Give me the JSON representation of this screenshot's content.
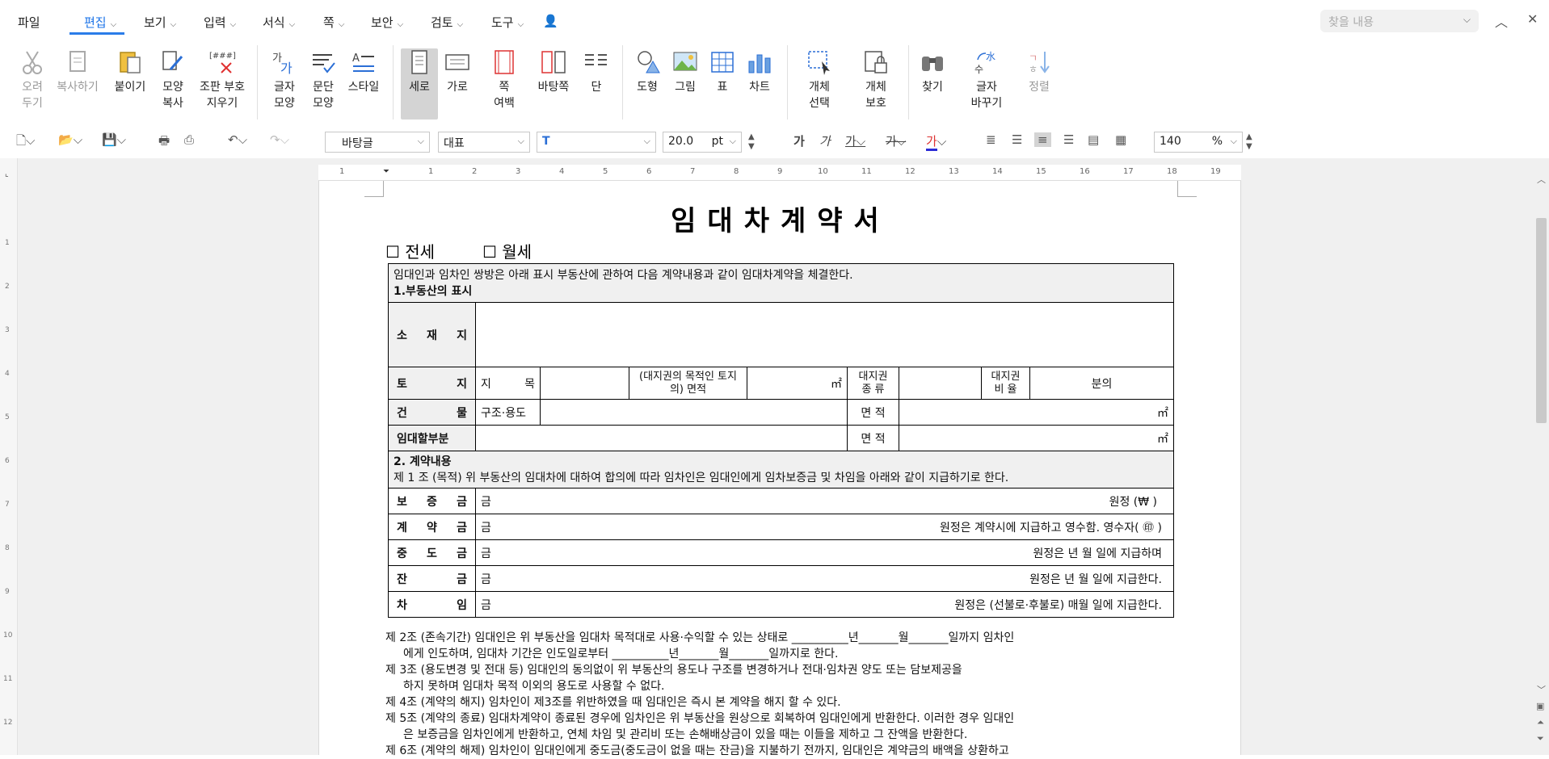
{
  "menu": {
    "file": "파일",
    "edit": "편집",
    "view": "보기",
    "input": "입력",
    "format": "서식",
    "page": "쪽",
    "security": "보안",
    "review": "검토",
    "tools": "도구"
  },
  "search": {
    "placeholder": "찾을 내용"
  },
  "ribbon": {
    "cut": "오려\n두기",
    "copy": "복사하기",
    "paste": "붙이기",
    "format_copy": "모양\n복사",
    "clear_layout": "조판 부호\n지우기",
    "char_shape": "글자\n모양",
    "para_shape": "문단\n모양",
    "style": "스타일",
    "portrait": "세로",
    "landscape": "가로",
    "margin": "쪽\n여백",
    "background": "바탕쪽",
    "columns": "단",
    "shape": "도형",
    "picture": "그림",
    "table": "표",
    "chart": "차트",
    "select_obj": "개체\n선택",
    "protect_obj": "개체\n보호",
    "find": "찾기",
    "replace": "글자\n바꾸기",
    "sort": "정렬"
  },
  "toolbar": {
    "style": "바탕글",
    "font_lang": "대표",
    "font": "",
    "size": "20.0",
    "unit": "pt",
    "zoom": "140",
    "zoom_unit": "%"
  },
  "ruler": {
    "h": [
      "1",
      "1",
      "2",
      "3",
      "4",
      "5",
      "6",
      "7",
      "8",
      "9",
      "10",
      "11",
      "12",
      "13",
      "14",
      "15",
      "16",
      "17",
      "18",
      "19"
    ],
    "v": [
      "1",
      "2",
      "3",
      "4",
      "5",
      "6",
      "7",
      "8",
      "9",
      "10",
      "11",
      "12"
    ]
  },
  "doc": {
    "title": "임대차계약서",
    "jeonse": "☐ 전세",
    "wolse": "☐ 월세",
    "intro": "임대인과 임차인 쌍방은 아래 표시 부동산에 관하여 다음 계약내용과 같이 임대차계약을 체결한다.",
    "sec1": "1.부동산의 표시",
    "location": "소 재 지",
    "land": "토 지",
    "jimok": "지 목",
    "land_area": "(대지권의 목적인 토지의) 면적",
    "sqm": "㎡",
    "land_type": "대지권 종 류",
    "land_ratio": "대지권 비 율",
    "fraction": "분의",
    "building": "건 물",
    "structure": "구조·용도",
    "area": "면 적",
    "rent_part": "임대할부분",
    "sec2": "2. 계약내용",
    "art1": "제 1 조 (목적) 위 부동산의 임대차에 대하여 합의에 따라 임차인은 임대인에게 임차보증금 및 차임을 아래와 같이 지급하기로 한다.",
    "deposit": "보 증 금",
    "deposit_text": "원정 (₩                                        )",
    "contract": "계 약 금",
    "contract_text": "원정은 계약시에 지급하고 영수함.  영수자(                              ㊞ )",
    "middle": "중 도 금",
    "middle_text": "원정은          년          월          일에 지급하며",
    "balance": "잔 금",
    "balance_text": "원정은          년          월          일에 지급한다.",
    "rent": "차 임",
    "rent_text": "원정은 (선불로·후불로) 매월       일에 지급한다.",
    "won": "금",
    "art2a": "제 2조 (존속기간) 임대인은 위 부동산을 임대차 목적대로 사용·수익할 수 있는 상태로  __________년_______월_______일까지 임차인",
    "art2b": "에게 인도하며, 임대차 기간은 인도일로부터  __________년_______월_______일까지로 한다.",
    "art3a": "제 3조 (용도변경 및 전대 등) 임대인의 동의없이 위 부동산의 용도나 구조를 변경하거나 전대·임차권 양도 또는 담보제공을",
    "art3b": "하지 못하며 임대차 목적 이외의 용도로 사용할 수 없다.",
    "art4": "제 4조 (계약의 해지) 임차인이 제3조를 위반하였을 때 임대인은 즉시 본 계약을 해지 할 수 있다.",
    "art5a": "제 5조 (계약의 종료) 임대차계약이 종료된 경우에 임차인은 위 부동산을 원상으로 회복하여 임대인에게 반환한다. 이러한 경우 임대인",
    "art5b": "은 보증금을 임차인에게 반환하고, 연체 차임 및 관리비 또는 손해배상금이 있을 때는 이들을 제하고 그 잔액을 반환한다.",
    "art6": "제 6조 (계약의 해제) 임차인이 임대인에게 중도금(중도금이 없을 때는 잔금)을 지불하기 전까지, 임대인은 계약금의 배액을 상환하고"
  }
}
